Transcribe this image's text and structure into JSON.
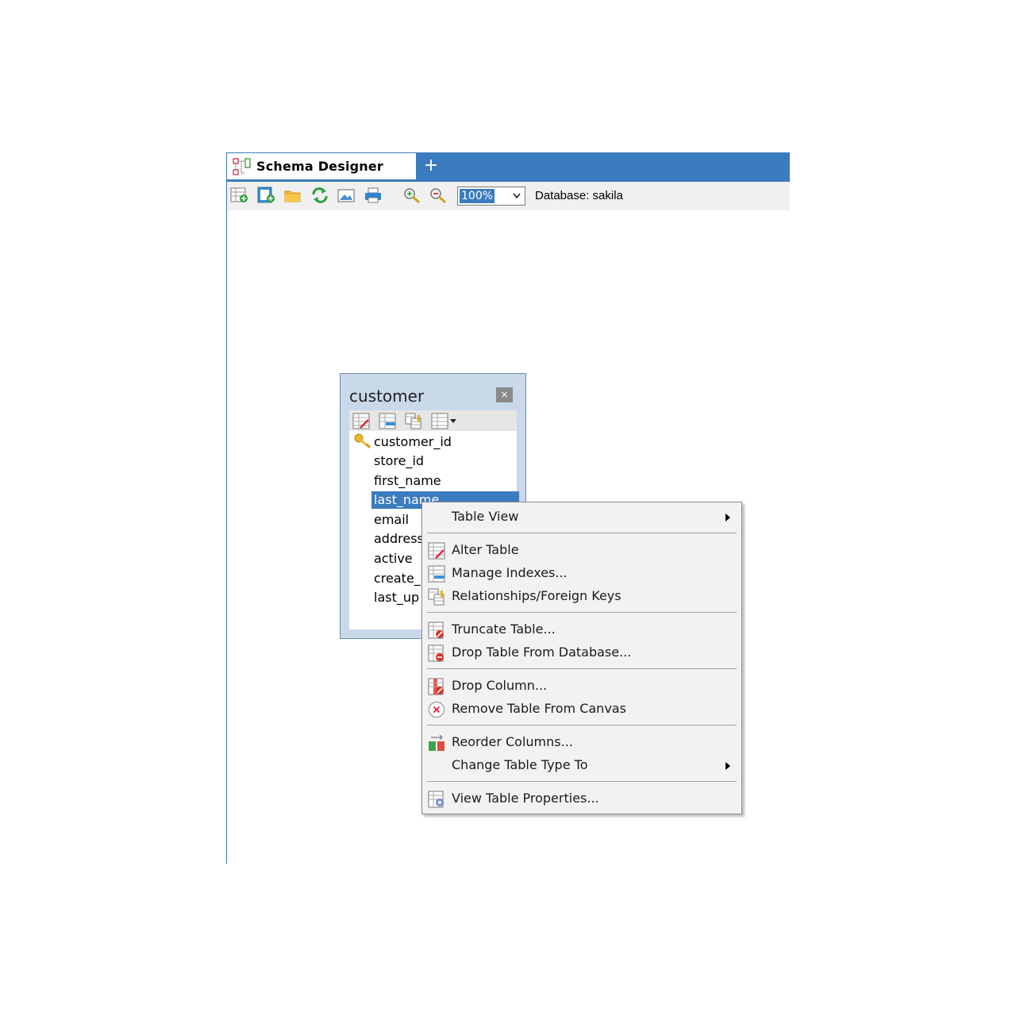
{
  "window": {
    "tab_title": "Schema Designer",
    "new_tab_label": "+"
  },
  "toolbar": {
    "buttons": [
      "add-table-icon",
      "add-view-icon",
      "open-folder-icon",
      "refresh-icon",
      "export-image-icon",
      "print-icon",
      "zoom-in-icon",
      "zoom-out-icon"
    ],
    "zoom_value": "100%",
    "database_label": "Database: sakila"
  },
  "table": {
    "name": "customer",
    "close_label": "×",
    "columns": [
      "customer_id",
      "store_id",
      "first_name",
      "last_name",
      "email",
      "address",
      "active",
      "create_",
      "last_up"
    ],
    "primary_key": "customer_id",
    "selected_column": "last_name"
  },
  "context_menu": {
    "items": [
      {
        "label": "Table View",
        "icon": "",
        "submenu": true
      },
      {
        "label": "Alter Table",
        "icon": "alter-table-icon"
      },
      {
        "label": "Manage Indexes...",
        "icon": "manage-indexes-icon"
      },
      {
        "label": "Relationships/Foreign Keys",
        "icon": "relationships-icon"
      },
      {
        "label": "Truncate Table...",
        "icon": "truncate-table-icon"
      },
      {
        "label": "Drop Table From Database...",
        "icon": "drop-table-icon"
      },
      {
        "label": "Drop Column...",
        "icon": "drop-column-icon"
      },
      {
        "label": "Remove Table From Canvas",
        "icon": "remove-table-icon"
      },
      {
        "label": "Reorder Columns...",
        "icon": "reorder-columns-icon"
      },
      {
        "label": "Change Table Type To",
        "icon": "",
        "submenu": true
      },
      {
        "label": "View Table Properties...",
        "icon": "table-properties-icon"
      }
    ]
  },
  "colors": {
    "accent": "#3b7bbf",
    "table_frame": "#c9d9ea",
    "menu_background": "#f2f2f2"
  }
}
